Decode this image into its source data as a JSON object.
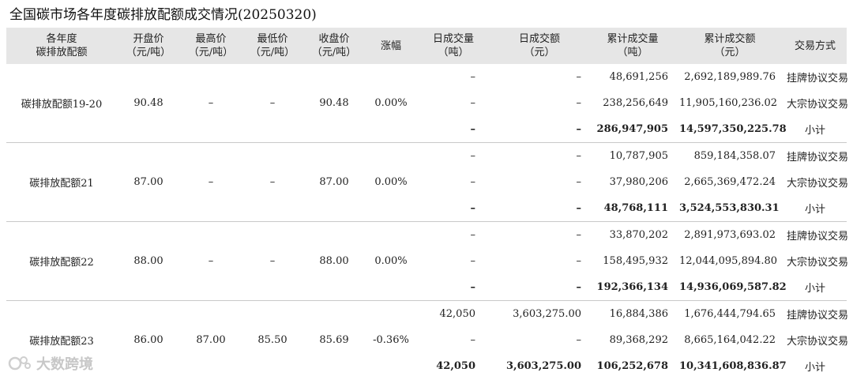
{
  "title": "全国碳市场各年度碳排放配额成交情况(20250320)",
  "headers": [
    [
      "各年度",
      "碳排放配额"
    ],
    [
      "开盘价",
      "（元/吨）"
    ],
    [
      "最高价",
      "（元/吨）"
    ],
    [
      "最低价",
      "（元/吨）"
    ],
    [
      "收盘价",
      "（元/吨）"
    ],
    [
      "涨幅"
    ],
    [
      "日成交量",
      "（吨）"
    ],
    [
      "日成交额",
      "（元）"
    ],
    [
      "累计成交量",
      "（吨）"
    ],
    [
      "累计成交额",
      "（元）"
    ],
    [
      "交易方式"
    ]
  ],
  "groups": [
    {
      "name": "碳排放配额19-20",
      "open": "90.48",
      "high": "–",
      "low": "–",
      "close": "90.48",
      "change": "0.00%",
      "rows": [
        {
          "daily_vol": "–",
          "daily_amt": "–",
          "cum_vol": "48,691,256",
          "cum_amt": "2,692,189,989.76",
          "method": "挂牌协议交易"
        },
        {
          "daily_vol": "–",
          "daily_amt": "–",
          "cum_vol": "238,256,649",
          "cum_amt": "11,905,160,236.02",
          "method": "大宗协议交易"
        },
        {
          "daily_vol": "–",
          "daily_amt": "–",
          "cum_vol": "286,947,905",
          "cum_amt": "14,597,350,225.78",
          "method": "小计"
        }
      ]
    },
    {
      "name": "碳排放配额21",
      "open": "87.00",
      "high": "–",
      "low": "–",
      "close": "87.00",
      "change": "0.00%",
      "rows": [
        {
          "daily_vol": "–",
          "daily_amt": "–",
          "cum_vol": "10,787,905",
          "cum_amt": "859,184,358.07",
          "method": "挂牌协议交易"
        },
        {
          "daily_vol": "–",
          "daily_amt": "–",
          "cum_vol": "37,980,206",
          "cum_amt": "2,665,369,472.24",
          "method": "大宗协议交易"
        },
        {
          "daily_vol": "–",
          "daily_amt": "–",
          "cum_vol": "48,768,111",
          "cum_amt": "3,524,553,830.31",
          "method": "小计"
        }
      ]
    },
    {
      "name": "碳排放配额22",
      "open": "88.00",
      "high": "–",
      "low": "–",
      "close": "88.00",
      "change": "0.00%",
      "rows": [
        {
          "daily_vol": "–",
          "daily_amt": "–",
          "cum_vol": "33,870,202",
          "cum_amt": "2,891,973,693.02",
          "method": "挂牌协议交易"
        },
        {
          "daily_vol": "–",
          "daily_amt": "–",
          "cum_vol": "158,495,932",
          "cum_amt": "12,044,095,894.80",
          "method": "大宗协议交易"
        },
        {
          "daily_vol": "–",
          "daily_amt": "–",
          "cum_vol": "192,366,134",
          "cum_amt": "14,936,069,587.82",
          "method": "小计"
        }
      ]
    },
    {
      "name": "碳排放配额23",
      "open": "86.00",
      "high": "87.00",
      "low": "85.50",
      "close": "85.69",
      "change": "-0.36%",
      "rows": [
        {
          "daily_vol": "42,050",
          "daily_amt": "3,603,275.00",
          "cum_vol": "16,884,386",
          "cum_amt": "1,676,444,794.65",
          "method": "挂牌协议交易"
        },
        {
          "daily_vol": "–",
          "daily_amt": "–",
          "cum_vol": "89,368,292",
          "cum_amt": "8,665,164,042.22",
          "method": "大宗协议交易"
        },
        {
          "daily_vol": "42,050",
          "daily_amt": "3,603,275.00",
          "cum_vol": "106,252,678",
          "cum_amt": "10,341,608,836.87",
          "method": "小计"
        }
      ]
    }
  ],
  "watermark": {
    "text": "大数跨境",
    "icon": "brand-logo-icon"
  }
}
